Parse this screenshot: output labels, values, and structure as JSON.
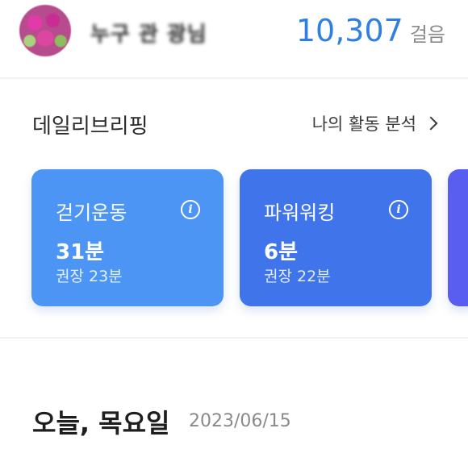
{
  "header": {
    "username": "누구 관 광님",
    "steps_value": "10,307",
    "steps_unit": "걸음"
  },
  "briefing": {
    "title": "데일리브리핑",
    "analysis_link": "나의 활동 분석",
    "cards": [
      {
        "title": "걷기운동",
        "value": "31분",
        "recommended": "권장 23분",
        "info_icon": "info-icon"
      },
      {
        "title": "파워워킹",
        "value": "6분",
        "recommended": "권장 22분",
        "info_icon": "info-icon"
      }
    ]
  },
  "today": {
    "day_label": "오늘, 목요일",
    "date": "2023/06/15"
  },
  "colors": {
    "steps_accent": "#2f7fe0",
    "card_walk": "#4d95f5",
    "card_power": "#3f74ea",
    "card_next": "#5a5ef0"
  }
}
